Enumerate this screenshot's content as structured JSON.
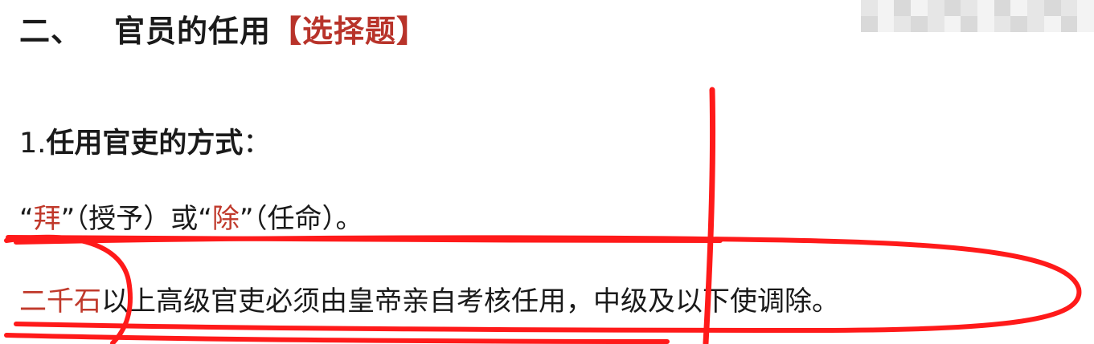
{
  "heading": {
    "number": "二、",
    "text": "官员的任用",
    "tag": "【选择题】"
  },
  "section": {
    "number": "1.",
    "title": "任用官吏的方式",
    "colon": "："
  },
  "terms_line": {
    "q1_open": "“",
    "term1": "拜",
    "q1_close": "”",
    "gloss1": "（授予）或",
    "q2_open": "“",
    "term2": "除",
    "q2_close": "”",
    "gloss2": "（任命）。"
  },
  "rule_line": {
    "highlight": "二千石",
    "text": "以上高级官吏必须由皇帝亲自考核任用，中级及以下使调除。"
  },
  "colors": {
    "accent_red": "#c0392b",
    "annotation_red": "#ff1a1a"
  }
}
